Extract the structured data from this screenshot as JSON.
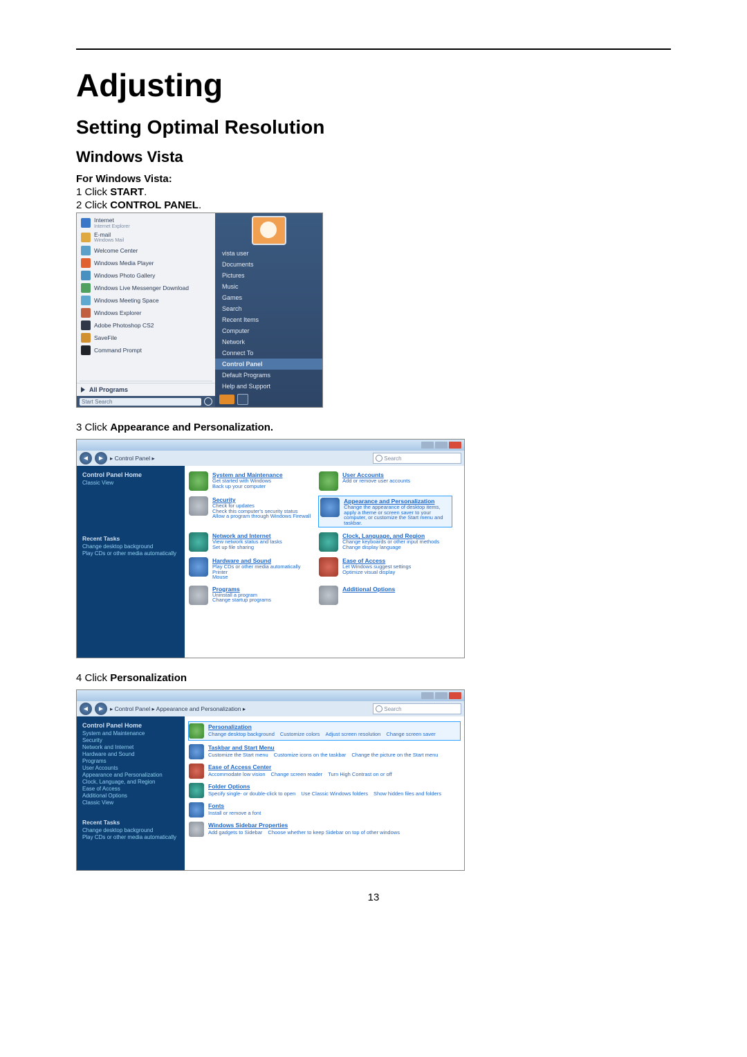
{
  "page_number": "13",
  "title": "Adjusting",
  "section": "Setting Optimal Resolution",
  "subsection": "Windows Vista",
  "intro": "For Windows Vista:",
  "steps": {
    "s1_pre": "1 Click ",
    "s1_bold": "START",
    "s1_post": ".",
    "s2_pre": "2 Click ",
    "s2_bold": "CONTROL PANEL",
    "s2_post": ".",
    "s3_pre": "3 Click ",
    "s3_bold": "Appearance and Personalization.",
    "s4_pre": "4 Click ",
    "s4_bold": "Personalization"
  },
  "start_menu": {
    "left": [
      {
        "label": "Internet",
        "sub": "Internet Explorer",
        "icon": "#3a77c8"
      },
      {
        "label": "E-mail",
        "sub": "Windows Mail",
        "icon": "#e0a840"
      },
      {
        "label": "Welcome Center",
        "sub": "",
        "icon": "#5aa0c8"
      },
      {
        "label": "Windows Media Player",
        "sub": "",
        "icon": "#e06030"
      },
      {
        "label": "Windows Photo Gallery",
        "sub": "",
        "icon": "#4890c0"
      },
      {
        "label": "Windows Live Messenger Download",
        "sub": "",
        "icon": "#50a060"
      },
      {
        "label": "Windows Meeting Space",
        "sub": "",
        "icon": "#60a8d0"
      },
      {
        "label": "Windows Explorer",
        "sub": "",
        "icon": "#c06040"
      },
      {
        "label": "Adobe Photoshop CS2",
        "sub": "",
        "icon": "#303848"
      },
      {
        "label": "SaveFile",
        "sub": "",
        "icon": "#d09030"
      },
      {
        "label": "Command Prompt",
        "sub": "",
        "icon": "#202428"
      }
    ],
    "all_programs": "All Programs",
    "search_placeholder": "Start Search",
    "right": [
      "vista user",
      "Documents",
      "Pictures",
      "Music",
      "Games",
      "Search",
      "Recent Items",
      "Computer",
      "Network",
      "Connect To",
      "Control Panel",
      "Default Programs",
      "Help and Support"
    ],
    "right_highlight": "Control Panel"
  },
  "control_panel": {
    "breadcrumb": "▸ Control Panel ▸",
    "search_placeholder": "Search",
    "side": {
      "heading": "Control Panel Home",
      "link1": "Classic View",
      "recent_heading": "Recent Tasks",
      "recent1": "Change desktop background",
      "recent2": "Play CDs or other media automatically"
    },
    "left_col": [
      {
        "name": "System and Maintenance",
        "desc": [
          "Get started with Windows",
          "Back up your computer"
        ],
        "cls": "c-green"
      },
      {
        "name": "Security",
        "desc": [
          "Check for updates",
          "Check this computer's security status",
          "Allow a program through Windows Firewall"
        ],
        "cls": "c-grey"
      },
      {
        "name": "Network and Internet",
        "desc": [
          "View network status and tasks",
          "Set up file sharing"
        ],
        "cls": "c-teal"
      },
      {
        "name": "Hardware and Sound",
        "desc": [
          "Play CDs or other media automatically",
          "Printer",
          "Mouse"
        ],
        "cls": "c-blue"
      },
      {
        "name": "Programs",
        "desc": [
          "Uninstall a program",
          "Change startup programs"
        ],
        "cls": "c-grey"
      }
    ],
    "right_col": [
      {
        "name": "User Accounts",
        "desc": [
          "Add or remove user accounts"
        ],
        "cls": "c-green"
      },
      {
        "name": "Appearance and Personalization",
        "desc": [
          "Change the appearance of desktop items, apply a theme or screen saver to your computer, or customize the Start menu and taskbar."
        ],
        "cls": "c-blue",
        "hl": true
      },
      {
        "name": "Clock, Language, and Region",
        "desc": [
          "Change keyboards or other input methods",
          "Change display language"
        ],
        "cls": "c-teal"
      },
      {
        "name": "Ease of Access",
        "desc": [
          "Let Windows suggest settings",
          "Optimize visual display"
        ],
        "cls": "c-red"
      },
      {
        "name": "Additional Options",
        "desc": [],
        "cls": "c-grey"
      }
    ]
  },
  "appearance_panel": {
    "breadcrumb": "▸ Control Panel ▸ Appearance and Personalization ▸",
    "search_placeholder": "Search",
    "side": {
      "heading": "Control Panel Home",
      "links": [
        "System and Maintenance",
        "Security",
        "Network and Internet",
        "Hardware and Sound",
        "Programs",
        "User Accounts",
        "Appearance and Personalization",
        "Clock, Language, and Region",
        "Ease of Access",
        "Additional Options"
      ],
      "classic": "Classic View",
      "recent_heading": "Recent Tasks",
      "recent1": "Change desktop background",
      "recent2": "Play CDs or other media automatically"
    },
    "rows": [
      {
        "name": "Personalization",
        "sub": [
          "Change desktop background",
          "Customize colors",
          "Adjust screen resolution",
          "Change screen saver"
        ],
        "cls": "c-green",
        "hl": true
      },
      {
        "name": "Taskbar and Start Menu",
        "sub": [
          "Customize the Start menu",
          "Customize icons on the taskbar",
          "Change the picture on the Start menu"
        ],
        "cls": "c-blue"
      },
      {
        "name": "Ease of Access Center",
        "sub": [
          "Accommodate low vision",
          "Change screen reader",
          "Turn High Contrast on or off"
        ],
        "cls": "c-red"
      },
      {
        "name": "Folder Options",
        "sub": [
          "Specify single- or double-click to open",
          "Use Classic Windows folders",
          "Show hidden files and folders"
        ],
        "cls": "c-teal"
      },
      {
        "name": "Fonts",
        "sub": [
          "Install or remove a font"
        ],
        "cls": "c-blue"
      },
      {
        "name": "Windows Sidebar Properties",
        "sub": [
          "Add gadgets to Sidebar",
          "Choose whether to keep Sidebar on top of other windows"
        ],
        "cls": "c-grey"
      }
    ]
  }
}
